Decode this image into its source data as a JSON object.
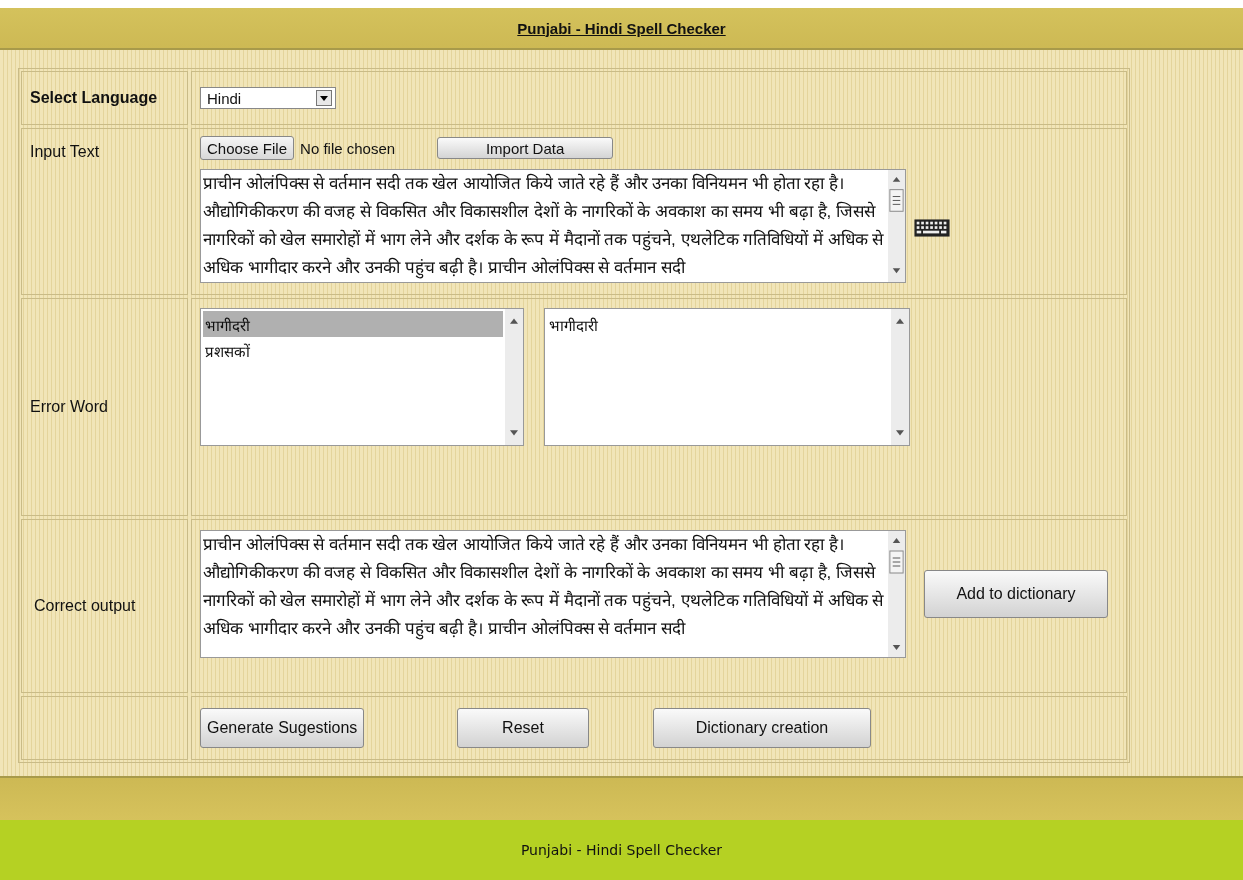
{
  "header": {
    "title": "Punjabi - Hindi Spell Checker"
  },
  "language": {
    "label": "Select Language",
    "value": "Hindi"
  },
  "input": {
    "label": "Input Text",
    "choose_file": "Choose File",
    "file_status": "No file chosen",
    "import_button": "Import Data",
    "text": "प्राचीन ओलंपिक्स से वर्तमान सदी तक खेल आयोजित किये जाते रहे हैं और उनका विनियमन भी होता रहा है। औद्योगिकीकरण की वजह से विकसित और विकासशील देशों के नागरिकों के अवकाश का समय भी बढ़ा है, जिससे नागरिकों को खेल समारोहों में भाग लेने और दर्शक के रूप में मैदानों तक पहुंचने, एथलेटिक गतिविधियों में अधिक से अधिक भागीदार करने और उनकी पहुंच बढ़ी है। प्राचीन ओलंपिक्स से वर्तमान सदी"
  },
  "errors": {
    "label": "Error Word",
    "words": [
      {
        "text": "भागीदरी",
        "selected": true
      },
      {
        "text": "प्रशसकों",
        "selected": false
      }
    ],
    "suggestions": [
      {
        "text": "भागीदारी",
        "selected": false
      }
    ]
  },
  "output": {
    "label": "Correct output",
    "text": "प्राचीन ओलंपिक्स से वर्तमान सदी तक खेल आयोजित किये जाते रहे हैं और उनका विनियमन भी होता रहा है। औद्योगिकीकरण की वजह से विकसित और विकासशील देशों के नागरिकों के अवकाश का समय भी बढ़ा है, जिससे नागरिकों को खेल समारोहों में भाग लेने और दर्शक के रूप में मैदानों तक पहुंचने, एथलेटिक गतिविधियों में अधिक से अधिक भागीदार करने और उनकी पहुंच बढ़ी है। प्राचीन ओलंपिक्स से वर्तमान सदी",
    "add_button": "Add to dictionary"
  },
  "actions": [
    "Generate Sugestions",
    "Reset",
    "Dictionary creation"
  ],
  "footer": {
    "text": "Punjabi - Hindi Spell Checker"
  }
}
